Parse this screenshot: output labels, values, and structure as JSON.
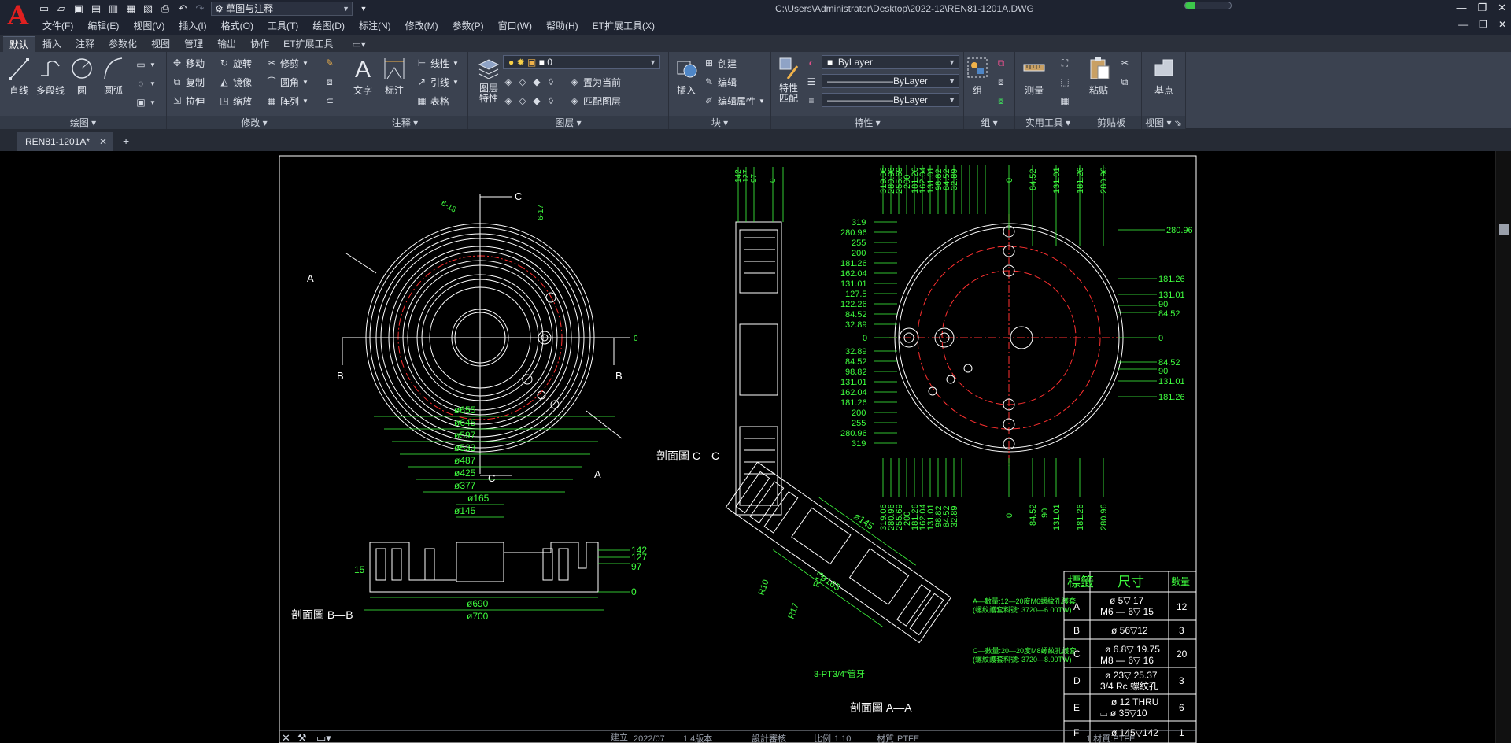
{
  "app": {
    "logo_letter": "A",
    "workspace": "草图与注释",
    "doc_path": "C:\\Users\\Administrator\\Desktop\\2022-12\\REN81-1201A.DWG",
    "progress_fraction": 0.2
  },
  "menu": [
    "文件(F)",
    "编辑(E)",
    "视图(V)",
    "插入(I)",
    "格式(O)",
    "工具(T)",
    "绘图(D)",
    "标注(N)",
    "修改(M)",
    "参数(P)",
    "窗口(W)",
    "帮助(H)",
    "ET扩展工具(X)"
  ],
  "ribbon_tabs": [
    "默认",
    "插入",
    "注释",
    "参数化",
    "视图",
    "管理",
    "输出",
    "协作",
    "ET扩展工具"
  ],
  "ribbon": {
    "draw": {
      "title": "绘图",
      "line": "直线",
      "polyline": "多段线",
      "circle": "圆",
      "arc": "圆弧"
    },
    "modify": {
      "title": "修改",
      "move": "移动",
      "rotate": "旋转",
      "trim": "修剪",
      "copy": "复制",
      "mirror": "镜像",
      "fillet": "圆角",
      "stretch": "拉伸",
      "scale": "缩放",
      "array": "阵列"
    },
    "annotation": {
      "title": "注释",
      "text": "文字",
      "dimension": "标注",
      "linear": "线性",
      "leader": "引线",
      "table": "表格"
    },
    "layers": {
      "title": "图层",
      "properties": "图层特性",
      "current_layer": "0",
      "set_current": "置为当前",
      "match": "匹配图层"
    },
    "block": {
      "title": "块",
      "insert": "插入",
      "create": "创建",
      "edit": "编辑",
      "edit_attr": "编辑属性"
    },
    "properties": {
      "title": "特性",
      "match": "特性匹配",
      "color": "ByLayer",
      "linetype": "ByLayer",
      "lineweight": "ByLayer"
    },
    "groups": {
      "title": "组",
      "group": "组"
    },
    "utilities": {
      "title": "实用工具",
      "measure": "测量"
    },
    "clipboard": {
      "title": "剪贴板",
      "paste": "粘贴"
    },
    "view": {
      "title": "视图",
      "base": "基点"
    }
  },
  "file_tab": "REN81-1201A*",
  "drawing": {
    "section_labels": {
      "cc": "剖面圖 C—C",
      "bb": "剖面圖 B—B",
      "aa": "剖面圖 A—A"
    },
    "markers": {
      "a": "A",
      "b": "B",
      "c": "C"
    },
    "left_dims": [
      "6-17",
      "6-18"
    ],
    "bb_dims": [
      "ø655",
      "ø645",
      "ø597",
      "ø533",
      "ø487",
      "ø425",
      "ø377",
      "ø165",
      "ø145",
      "ø690",
      "ø700"
    ],
    "bb_right": [
      "142",
      "127",
      "97"
    ],
    "cc_dims": [
      "142",
      "127",
      "97",
      "0"
    ],
    "right_top": [
      "319.06",
      "280.96",
      "255.69",
      "200",
      "181.26",
      "162.04",
      "131.01",
      "98.82",
      "84.52",
      "32.89",
      "0"
    ],
    "right_top2": [
      "84.52",
      "131.01",
      "181.26",
      "280.96"
    ],
    "right_left": [
      "319",
      "280.96",
      "255",
      "200",
      "181.26",
      "162.04",
      "131.01",
      "127.5",
      "122.26",
      "84.52",
      "32.89",
      "0",
      "32.89",
      "84.52",
      "98.82",
      "131.01",
      "162.04",
      "181.26",
      "200",
      "255",
      "280.96",
      "319"
    ],
    "right_right": [
      "280.96",
      "181.26",
      "131.01",
      "90",
      "84.52",
      "0",
      "84.52",
      "90",
      "131.01",
      "181.26"
    ],
    "right_bottom": [
      "319.06",
      "280.96",
      "255.69",
      "200",
      "181.26",
      "162.04",
      "131.01",
      "98.82",
      "84.52",
      "32.89",
      "0"
    ],
    "right_bottom2": [
      "84.52",
      "90",
      "131.01",
      "181.26",
      "280.96"
    ],
    "aa_dims": [
      "ø145",
      "ø165",
      "R10",
      "R17",
      "R13",
      "3-PT3/4\"管牙"
    ],
    "note_a": "A—數量:12—20度M6螺紋孔護套",
    "note_a2": "(螺紋護套料號: 3720—6.00TW)",
    "note_c": "C—數量:20—20度M8螺紋孔護套",
    "note_c2": "(螺紋護套料號: 3720—8.00TW)",
    "table": {
      "headers": [
        "標籤",
        "尺寸",
        "數量"
      ],
      "rows": [
        {
          "tag": "A",
          "size1": "ø 5▽ 17",
          "size2": "M6 — 6▽ 15",
          "qty": "12"
        },
        {
          "tag": "B",
          "size1": "ø 56▽12",
          "size2": "",
          "qty": "3"
        },
        {
          "tag": "C",
          "size1": "ø 6.8▽ 19.75",
          "size2": "M8 — 6▽ 16",
          "qty": "20"
        },
        {
          "tag": "D",
          "size1": "ø 23▽ 25.37",
          "size2": "3/4 Rc 螺紋孔",
          "qty": "3"
        },
        {
          "tag": "E",
          "size1": "ø 12 THRU",
          "size2": "⌴ ø 35▽10",
          "qty": "6"
        },
        {
          "tag": "F",
          "size1": "ø 145▽142",
          "size2": "",
          "qty": "1"
        }
      ]
    },
    "titleblock": [
      "建立",
      "2022/07",
      "1.4版本",
      "設計審核",
      "比例",
      "1:10",
      "材質",
      "PTFE",
      "1:材質:PTFE"
    ]
  },
  "colors": {
    "green": "#3fff3f",
    "red": "#ff3030",
    "white": "#ffffff",
    "gray": "#9aa0ab"
  }
}
